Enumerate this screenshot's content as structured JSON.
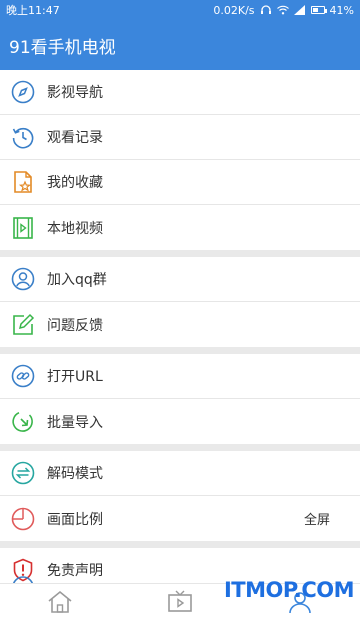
{
  "status_bar": {
    "time": "晚上11:47",
    "speed": "0.02K/s",
    "battery_level": 0.41,
    "battery_text": "41%"
  },
  "app_bar": {
    "title": "91看手机电视"
  },
  "menu": {
    "group1": [
      {
        "label": "影视导航",
        "icon": "compass-icon",
        "color": "#3a7fc8"
      },
      {
        "label": "观看记录",
        "icon": "history-icon",
        "color": "#3a7fc8"
      },
      {
        "label": "我的收藏",
        "icon": "favorite-doc-icon",
        "color": "#e38a26"
      },
      {
        "label": "本地视频",
        "icon": "local-video-icon",
        "color": "#39b54a"
      }
    ],
    "group2": [
      {
        "label": "加入qq群",
        "icon": "user-group-icon",
        "color": "#3a7fc8"
      },
      {
        "label": "问题反馈",
        "icon": "feedback-edit-icon",
        "color": "#39b54a"
      }
    ],
    "group3": [
      {
        "label": "打开URL",
        "icon": "link-icon",
        "color": "#3a7fc8"
      },
      {
        "label": "批量导入",
        "icon": "import-icon",
        "color": "#39b54a"
      }
    ],
    "group4": [
      {
        "label": "解码模式",
        "icon": "decode-switch-icon",
        "color": "#26a6a0"
      },
      {
        "label": "画面比例",
        "icon": "aspect-ratio-icon",
        "color": "#e05a5a",
        "value": "全屏"
      }
    ],
    "group5": [
      {
        "label": "免责声明",
        "icon": "warning-shield-icon",
        "color": "#d62f2f"
      }
    ]
  },
  "tabbar": {
    "items": [
      {
        "icon": "home-icon"
      },
      {
        "icon": "tv-icon"
      },
      {
        "icon": "profile-icon",
        "active": true
      }
    ]
  },
  "watermark": {
    "text": "ITMOP.COM"
  }
}
